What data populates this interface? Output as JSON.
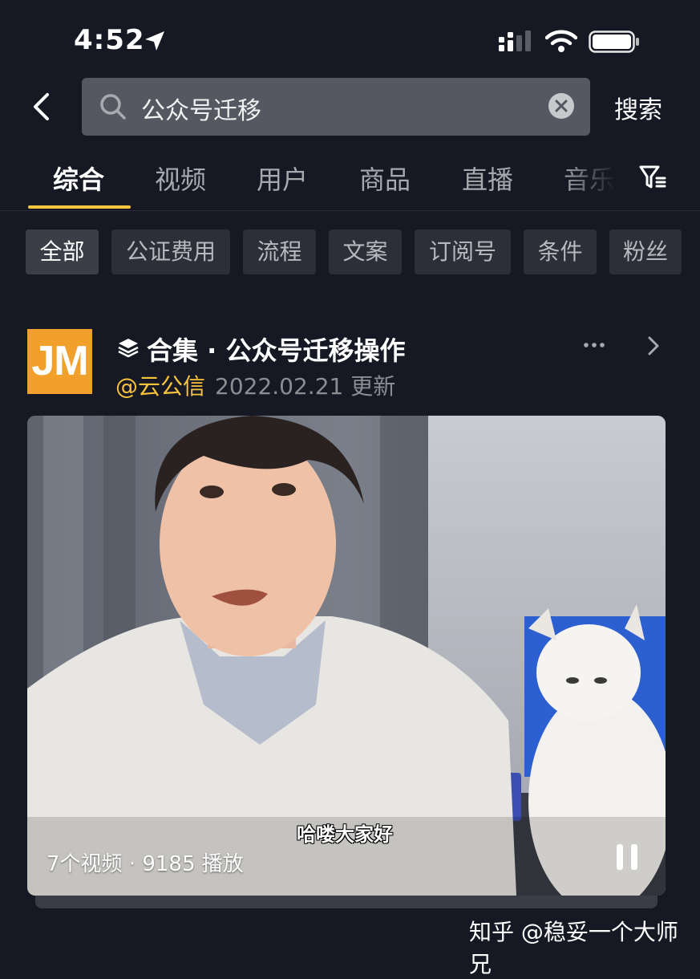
{
  "status_bar": {
    "time": "4:52"
  },
  "search": {
    "query": "公众号迁移",
    "submit_label": "搜索"
  },
  "tabs": [
    {
      "label": "综合"
    },
    {
      "label": "视频"
    },
    {
      "label": "用户"
    },
    {
      "label": "商品"
    },
    {
      "label": "直播"
    },
    {
      "label": "音乐"
    }
  ],
  "filter_chips": [
    {
      "label": "全部"
    },
    {
      "label": "公证费用"
    },
    {
      "label": "流程"
    },
    {
      "label": "文案"
    },
    {
      "label": "订阅号"
    },
    {
      "label": "条件"
    },
    {
      "label": "粉丝"
    }
  ],
  "collection": {
    "avatar_text": "JM",
    "title": "合集 · 公众号迁移操作",
    "author": "@云公信",
    "updated": "2022.02.21 更新",
    "video_meta": "7个视频 · 9185 播放",
    "subtitle": "哈喽大家好"
  },
  "watermark": "知乎 @稳妥一个大师兄",
  "colors": {
    "background": "#161823",
    "accent": "#f8c43c",
    "avatar": "#f1a02c",
    "chip": "#2c2e38"
  },
  "icons": [
    "location-arrow-icon",
    "signal-icon",
    "wifi-icon",
    "battery-icon",
    "back-arrow-icon",
    "search-icon",
    "clear-icon",
    "filter-icon",
    "stack-icon",
    "more-icon",
    "chevron-right-icon",
    "pause-icon"
  ]
}
